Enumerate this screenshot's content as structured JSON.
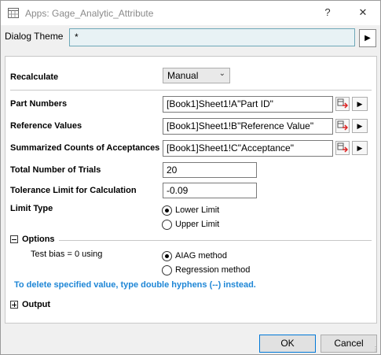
{
  "window": {
    "title": "Apps: Gage_Analytic_Attribute",
    "help_label": "?",
    "close_label": "✕"
  },
  "dialog_theme": {
    "label": "Dialog Theme",
    "value": "*"
  },
  "recalculate": {
    "label": "Recalculate",
    "value": "Manual"
  },
  "part_numbers": {
    "label": "Part Numbers",
    "value": "[Book1]Sheet1!A\"Part ID\""
  },
  "reference_values": {
    "label": "Reference Values",
    "value": "[Book1]Sheet1!B\"Reference Value\""
  },
  "summarized_counts": {
    "label": "Summarized Counts of Acceptances",
    "value": "[Book1]Sheet1!C\"Acceptance\""
  },
  "total_trials": {
    "label": "Total Number of Trials",
    "value": "20"
  },
  "tolerance_limit": {
    "label": "Tolerance Limit for Calculation",
    "value": "-0.09"
  },
  "limit_type": {
    "label": "Limit Type",
    "options": [
      "Lower Limit",
      "Upper Limit"
    ],
    "selected": "Lower Limit"
  },
  "options": {
    "label": "Options",
    "test_bias_label": "Test bias = 0 using",
    "methods": [
      "AIAG method",
      "Regression method"
    ],
    "selected": "AIAG method"
  },
  "hint": "To delete specified value, type double hyphens (--) instead.",
  "output": {
    "label": "Output"
  },
  "buttons": {
    "ok": "OK",
    "cancel": "Cancel"
  }
}
